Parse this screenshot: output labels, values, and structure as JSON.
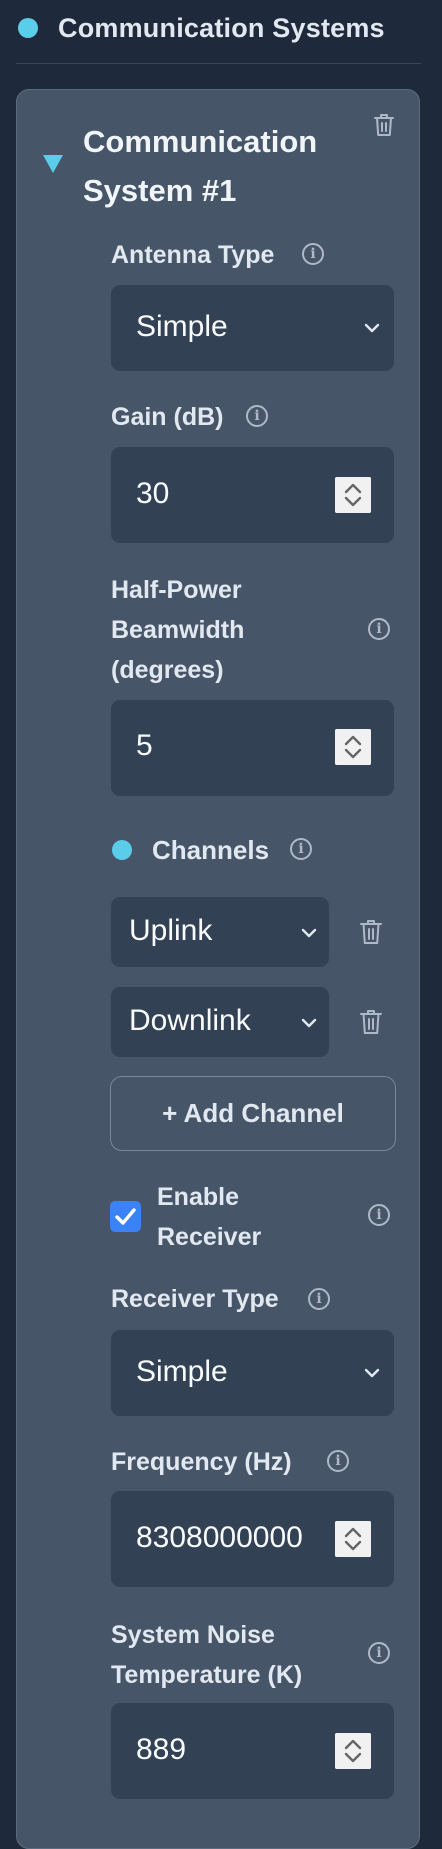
{
  "section": {
    "title": "Communication Systems"
  },
  "system": {
    "title": "Communication System #1",
    "antenna_type": {
      "label": "Antenna Type",
      "value": "Simple"
    },
    "gain": {
      "label": "Gain (dB)",
      "value": "30"
    },
    "beamwidth": {
      "label_lines": [
        "Half-Power",
        "Beamwidth",
        "(degrees)"
      ],
      "value": "5"
    },
    "channels": {
      "label": "Channels",
      "items": [
        {
          "value": "Uplink"
        },
        {
          "value": "Downlink"
        }
      ],
      "add_label": "+ Add Channel"
    },
    "enable_receiver": {
      "label_lines": [
        "Enable",
        "Receiver"
      ],
      "checked": true
    },
    "receiver_type": {
      "label": "Receiver Type",
      "value": "Simple"
    },
    "frequency": {
      "label": "Frequency (Hz)",
      "value": "8308000000"
    },
    "noise_temp": {
      "label_lines": [
        "System Noise",
        "Temperature (K)"
      ],
      "value": "889"
    }
  },
  "colors": {
    "accent_dot": "#5bcdea",
    "checkbox": "#3b82f6",
    "card_bg": "#475569",
    "field_bg": "#334155",
    "page_bg": "#1e293b"
  },
  "icons": [
    "info-icon",
    "trash-icon",
    "chevron-down-icon",
    "caret-down-icon",
    "checkmark-icon",
    "spinner-icon"
  ]
}
